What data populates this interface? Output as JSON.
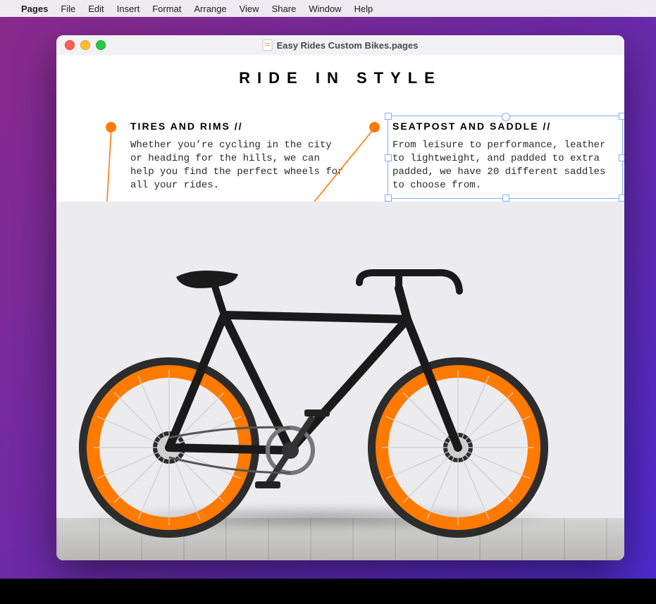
{
  "menubar": {
    "app": "Pages",
    "items": [
      "File",
      "Edit",
      "Insert",
      "Format",
      "Arrange",
      "View",
      "Share",
      "Window",
      "Help"
    ]
  },
  "window": {
    "title": "Easy Rides Custom Bikes.pages"
  },
  "document": {
    "title": "RIDE IN STYLE",
    "left": {
      "heading": "TIRES AND RIMS",
      "body": "Whether you’re cycling in the city or heading for the hills, we can help you find the perfect wheels for all your rides."
    },
    "right": {
      "heading": "SEATPOST AND SADDLE",
      "body": "From leisure to performance, leather to lightweight, and padded to extra padded, we have 20 different saddles to choose from."
    }
  },
  "colors": {
    "accent": "#ff7a00",
    "frame": "#1a1a1a"
  }
}
